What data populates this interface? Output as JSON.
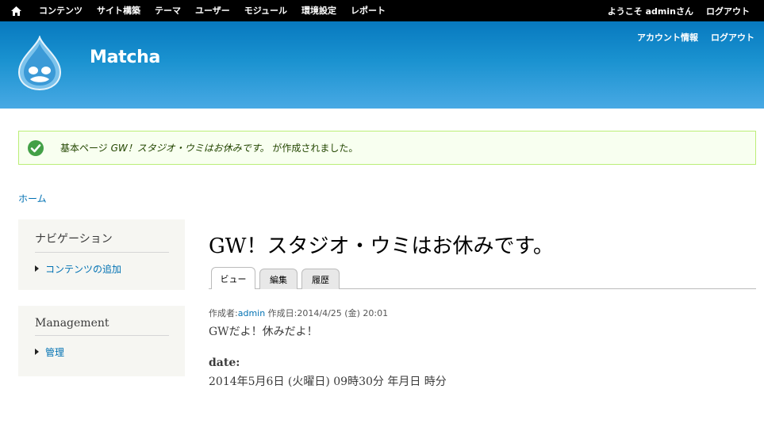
{
  "toolbar": {
    "home_icon": "home-icon",
    "menu": [
      "コンテンツ",
      "サイト構築",
      "テーマ",
      "ユーザー",
      "モジュール",
      "環境設定",
      "レポート"
    ],
    "welcome": "ようこそ adminさん",
    "logout": "ログアウト"
  },
  "header": {
    "logo_icon": "drupal-drop-icon",
    "site_name": "Matcha",
    "secondary": [
      "アカウント情報",
      "ログアウト"
    ]
  },
  "status": {
    "icon": "checkmark-icon",
    "prefix": "基本ページ ",
    "title": "GW！スタジオ・ウミはお休みです。",
    "suffix": " が作成されました。",
    "colors": {
      "background": "#f8fff0",
      "border": "#bbee77",
      "icon": "#43a047"
    }
  },
  "breadcrumb": {
    "home": "ホーム"
  },
  "sidebar": {
    "navigation": {
      "title": "ナビゲーション",
      "items": [
        "コンテンツの追加"
      ]
    },
    "management": {
      "title": "Management",
      "items": [
        "管理"
      ]
    }
  },
  "node": {
    "title": "GW！スタジオ・ウミはお休みです。",
    "tabs": [
      "ビュー",
      "編集",
      "履歴"
    ],
    "active_tab": "ビュー",
    "submitted_prefix": "作成者:",
    "author": "admin",
    "submitted_suffix": " 作成日:2014/4/25 (金) 20:01",
    "body": "GWだよ！休みだよ！",
    "field_label": "date:",
    "field_value": "2014年5月6日 (火曜日) 09時30分 年月日 時分"
  },
  "colors": {
    "link": "#0071b3",
    "header_top": "#0779bf",
    "header_bottom": "#48a9e4"
  }
}
